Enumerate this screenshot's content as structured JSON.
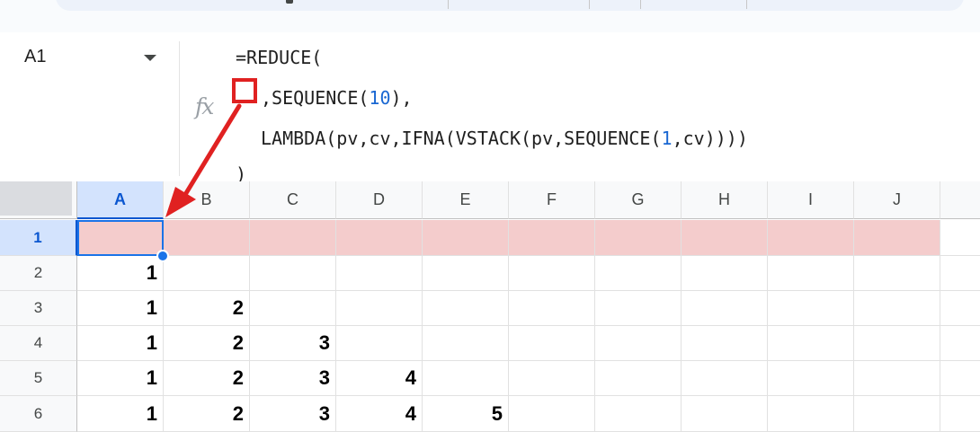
{
  "name_box": {
    "value": "A1"
  },
  "formula_bar": {
    "fx_label": "fx",
    "lines": [
      {
        "parts": [
          {
            "text": "=REDUCE(",
            "kind": "text"
          }
        ]
      },
      {
        "parts": [
          {
            "text": ",SEQUENCE(",
            "kind": "text"
          },
          {
            "text": "10",
            "kind": "number"
          },
          {
            "text": "),",
            "kind": "text"
          }
        ]
      },
      {
        "parts": [
          {
            "text": "LAMBDA(pv,cv,IFNA(VSTACK(pv,SEQUENCE(",
            "kind": "text"
          },
          {
            "text": "1",
            "kind": "number"
          },
          {
            "text": ",cv))))",
            "kind": "text"
          }
        ]
      },
      {
        "parts": [
          {
            "text": ")",
            "kind": "text"
          }
        ]
      }
    ]
  },
  "columns": [
    "A",
    "B",
    "C",
    "D",
    "E",
    "F",
    "G",
    "H",
    "I",
    "J"
  ],
  "selected_column": "A",
  "rows": [
    {
      "label": "1",
      "cells": [
        "",
        "",
        "",
        "",
        "",
        "",
        "",
        "",
        "",
        ""
      ]
    },
    {
      "label": "2",
      "cells": [
        "1",
        "",
        "",
        "",
        "",
        "",
        "",
        "",
        "",
        ""
      ]
    },
    {
      "label": "3",
      "cells": [
        "1",
        "2",
        "",
        "",
        "",
        "",
        "",
        "",
        "",
        ""
      ]
    },
    {
      "label": "4",
      "cells": [
        "1",
        "2",
        "3",
        "",
        "",
        "",
        "",
        "",
        "",
        ""
      ]
    },
    {
      "label": "5",
      "cells": [
        "1",
        "2",
        "3",
        "4",
        "",
        "",
        "",
        "",
        "",
        ""
      ]
    },
    {
      "label": "6",
      "cells": [
        "1",
        "2",
        "3",
        "4",
        "5",
        "",
        "",
        "",
        "",
        ""
      ]
    }
  ],
  "selected_row": "1",
  "colors": {
    "highlight_row": "#f4cccc",
    "selection": "#1a73e8",
    "annotation": "#e02121",
    "number_token": "#1967d2"
  }
}
